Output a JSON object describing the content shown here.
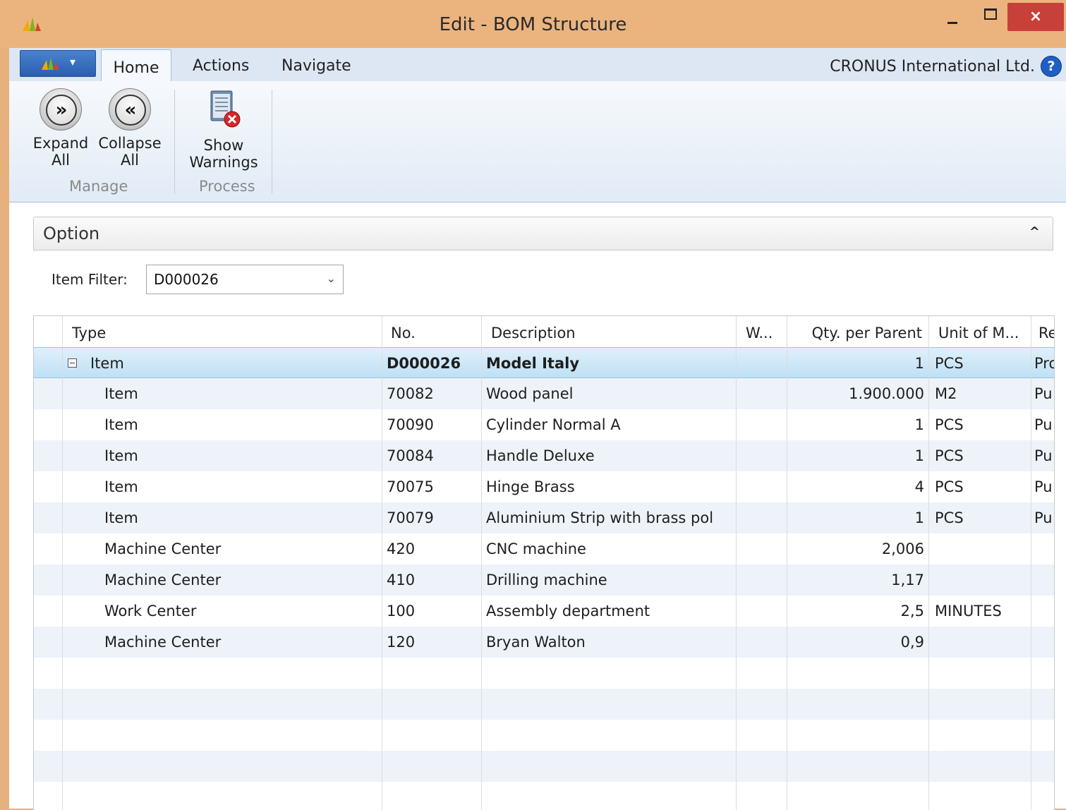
{
  "window": {
    "title": "Edit - BOM Structure",
    "close_label": "×"
  },
  "ribbon_tabs": {
    "home": "Home",
    "actions": "Actions",
    "navigate": "Navigate",
    "company": "CRONUS International Ltd.",
    "help": "?"
  },
  "ribbon": {
    "expand_all": [
      "Expand",
      "All"
    ],
    "collapse_all": [
      "Collapse",
      "All"
    ],
    "show_warnings": [
      "Show",
      "Warnings"
    ],
    "group_manage": "Manage",
    "group_process": "Process"
  },
  "option": {
    "title": "Option",
    "toggle": "^",
    "item_filter_label": "Item Filter:",
    "item_filter_value": "D000026"
  },
  "grid": {
    "columns": [
      "Type",
      "No.",
      "Description",
      "W...",
      "Qty. per Parent",
      "Unit of M...",
      "Re"
    ],
    "rows": [
      {
        "type": "Item",
        "no": "D000026",
        "description": "Model Italy",
        "w": "",
        "qty": "1",
        "uom": "PCS",
        "re": "Pro",
        "selected": true
      },
      {
        "type": "Item",
        "no": "70082",
        "description": "Wood panel",
        "w": "",
        "qty": "1.900.000",
        "uom": "M2",
        "re": "Pu"
      },
      {
        "type": "Item",
        "no": "70090",
        "description": "Cylinder Normal A",
        "w": "",
        "qty": "1",
        "uom": "PCS",
        "re": "Pu"
      },
      {
        "type": "Item",
        "no": "70084",
        "description": "Handle Deluxe",
        "w": "",
        "qty": "1",
        "uom": "PCS",
        "re": "Pu"
      },
      {
        "type": "Item",
        "no": "70075",
        "description": "Hinge Brass",
        "w": "",
        "qty": "4",
        "uom": "PCS",
        "re": "Pu"
      },
      {
        "type": "Item",
        "no": "70079",
        "description": "Aluminium Strip with brass pol",
        "w": "",
        "qty": "1",
        "uom": "PCS",
        "re": "Pu"
      },
      {
        "type": "Machine Center",
        "no": "420",
        "description": "CNC machine",
        "w": "",
        "qty": "2,006",
        "uom": "",
        "re": ""
      },
      {
        "type": "Machine Center",
        "no": "410",
        "description": "Drilling machine",
        "w": "",
        "qty": "1,17",
        "uom": "",
        "re": ""
      },
      {
        "type": "Work Center",
        "no": "100",
        "description": "Assembly department",
        "w": "",
        "qty": "2,5",
        "uom": "MINUTES",
        "re": ""
      },
      {
        "type": "Machine Center",
        "no": "120",
        "description": "Bryan Walton",
        "w": "",
        "qty": "0,9",
        "uom": "",
        "re": ""
      }
    ]
  },
  "colors": {
    "title_bar": "#ebb47f",
    "selected_row": "#bfe0f4",
    "alt_row": "#eef3fa",
    "close_button": "#c7403a"
  }
}
